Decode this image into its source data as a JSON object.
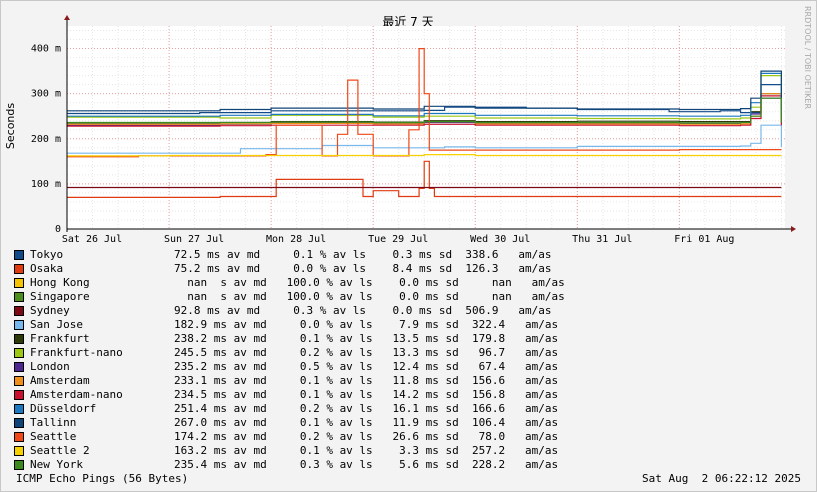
{
  "chart_data": {
    "type": "line",
    "title": "最近 7 天",
    "ylabel": "Seconds",
    "watermark": "RRDTOOL / TOBI OETIKER",
    "ylim": [
      0,
      450
    ],
    "y_ticks": [
      {
        "value": 0,
        "label": "0"
      },
      {
        "value": 100,
        "label": "100 m"
      },
      {
        "value": 200,
        "label": "200 m"
      },
      {
        "value": 300,
        "label": "300 m"
      },
      {
        "value": 400,
        "label": "400 m"
      }
    ],
    "x_range": [
      0,
      7
    ],
    "x_ticks": [
      {
        "value": 0,
        "label": "Sat 26 Jul"
      },
      {
        "value": 1,
        "label": "Sun 27 Jul"
      },
      {
        "value": 2,
        "label": "Mon 28 Jul"
      },
      {
        "value": 3,
        "label": "Tue 29 Jul"
      },
      {
        "value": 4,
        "label": "Wed 30 Jul"
      },
      {
        "value": 5,
        "label": "Thu 31 Jul"
      },
      {
        "value": 6,
        "label": "Fri 01 Aug"
      }
    ],
    "grid": true,
    "series": [
      {
        "name": "Tokyo",
        "color": "#124b8a",
        "stats": "72.5 ms av md     0.1 % av ls    0.3 ms sd  338.6   am/as",
        "x": [
          0,
          1.3,
          2.0,
          3.5,
          3.7,
          4.5,
          5.0,
          5.9,
          6.4,
          6.6,
          6.8,
          7.0
        ],
        "y": [
          256,
          258,
          262,
          263,
          270,
          268,
          265,
          260,
          262,
          258,
          320,
          255
        ]
      },
      {
        "name": "Osaka",
        "color": "#e03a10",
        "stats": "75.2 ms av md     0.0 % av ls    8.4 ms sd  126.3   am/as",
        "x": [
          0,
          0.9,
          1.5,
          1.95,
          2.05,
          2.9,
          3.0,
          3.25,
          3.45,
          3.5,
          3.55,
          3.6,
          4.2,
          5.0,
          6.0,
          6.5,
          7.0
        ],
        "y": [
          70,
          70,
          72,
          72,
          110,
          72,
          85,
          72,
          90,
          150,
          90,
          72,
          72,
          72,
          72,
          72,
          72
        ]
      },
      {
        "name": "Hong Kong",
        "color": "#f5c400",
        "stats": "  nan  s av md   100.0 % av ls    0.0 ms sd     nan   am/as",
        "x": [
          0,
          7
        ],
        "y": [
          null,
          null
        ]
      },
      {
        "name": "Singapore",
        "color": "#4b8e1e",
        "stats": "  nan  s av md   100.0 % av ls    0.0 ms sd     nan   am/as",
        "x": [
          0,
          7
        ],
        "y": [
          null,
          null
        ]
      },
      {
        "name": "Sydney",
        "color": "#7b0a14",
        "stats": "92.8 ms av md     0.3 % av ls    0.0 ms sd  506.9   am/as",
        "x": [
          0,
          7
        ],
        "y": [
          92,
          92
        ]
      },
      {
        "name": "San Jose",
        "color": "#78b8ec",
        "stats": "182.9 ms av md     0.0 % av ls    7.9 ms sd  322.4   am/as",
        "x": [
          0,
          1.0,
          1.7,
          2.5,
          3.0,
          3.7,
          4.0,
          5.0,
          6.0,
          6.6,
          6.7,
          6.8,
          7.0
        ],
        "y": [
          168,
          168,
          178,
          185,
          180,
          182,
          180,
          183,
          183,
          184,
          190,
          230,
          182
        ]
      },
      {
        "name": "Frankfurt",
        "color": "#2c3a06",
        "stats": "238.2 ms av md     0.1 % av ls   13.5 ms sd  179.8   am/as",
        "x": [
          0,
          1.5,
          2.0,
          3.0,
          3.5,
          4.0,
          5.0,
          6.0,
          6.6,
          6.7,
          6.8,
          7.0
        ],
        "y": [
          235,
          236,
          238,
          237,
          240,
          238,
          239,
          238,
          238,
          260,
          300,
          238
        ]
      },
      {
        "name": "Frankfurt-nano",
        "color": "#9cc814",
        "stats": "245.5 ms av md     0.2 % av ls   13.3 ms sd   96.7   am/as",
        "x": [
          0,
          1.5,
          2.0,
          3.0,
          3.5,
          4.0,
          5.0,
          6.0,
          6.6,
          6.7,
          6.8,
          7.0
        ],
        "y": [
          248,
          246,
          252,
          248,
          250,
          246,
          245,
          244,
          246,
          270,
          340,
          245
        ]
      },
      {
        "name": "London",
        "color": "#4e2790",
        "stats": "235.2 ms av md     0.5 % av ls   12.4 ms sd   67.4   am/as",
        "x": [
          0,
          1.5,
          2.0,
          3.0,
          3.5,
          4.0,
          5.0,
          6.0,
          6.6,
          6.7,
          6.8,
          7.0
        ],
        "y": [
          230,
          232,
          235,
          234,
          236,
          235,
          235,
          234,
          236,
          255,
          290,
          235
        ]
      },
      {
        "name": "Amsterdam",
        "color": "#f0901a",
        "stats": "233.1 ms av md     0.1 % av ls   11.8 ms sd  156.6   am/as",
        "x": [
          0,
          1.5,
          2.0,
          3.0,
          3.5,
          4.0,
          5.0,
          6.0,
          6.6,
          6.7,
          6.8,
          7.0
        ],
        "y": [
          232,
          233,
          234,
          233,
          238,
          233,
          233,
          232,
          233,
          250,
          300,
          233
        ]
      },
      {
        "name": "Amsterdam-nano",
        "color": "#c8102e",
        "stats": "234.5 ms av md     0.1 % av ls   14.2 ms sd  156.8   am/as",
        "x": [
          0,
          1.5,
          2.0,
          3.0,
          3.5,
          4.0,
          5.0,
          6.0,
          6.6,
          6.7,
          6.8,
          7.0
        ],
        "y": [
          228,
          229,
          230,
          230,
          232,
          230,
          230,
          229,
          230,
          245,
          295,
          230
        ]
      },
      {
        "name": "Düsseldorf",
        "color": "#1e78c0",
        "stats": "251.4 ms av md     0.2 % av ls   16.1 ms sd  166.6   am/as",
        "x": [
          0,
          1.5,
          2.0,
          3.0,
          3.5,
          4.0,
          5.0,
          6.0,
          6.6,
          6.7,
          6.8,
          7.0
        ],
        "y": [
          250,
          252,
          254,
          251,
          256,
          252,
          251,
          250,
          252,
          280,
          345,
          251
        ]
      },
      {
        "name": "Tallinn",
        "color": "#0f4478",
        "stats": "267.0 ms av md     0.1 % av ls   11.9 ms sd  106.4   am/as",
        "x": [
          0,
          1.5,
          2.0,
          3.0,
          3.5,
          4.0,
          5.0,
          6.0,
          6.6,
          6.7,
          6.8,
          7.0
        ],
        "y": [
          262,
          265,
          268,
          266,
          272,
          268,
          266,
          265,
          267,
          290,
          350,
          267
        ]
      },
      {
        "name": "Seattle",
        "color": "#f04818",
        "stats": "174.2 ms av md     0.2 % av ls   26.6 ms sd   78.0   am/as",
        "x": [
          0,
          0.7,
          1.5,
          1.95,
          2.05,
          2.5,
          2.65,
          2.75,
          2.85,
          3.0,
          3.35,
          3.45,
          3.5,
          3.55,
          3.65,
          4.0,
          5.0,
          6.0,
          7.0
        ],
        "y": [
          160,
          162,
          162,
          165,
          230,
          162,
          210,
          330,
          210,
          162,
          220,
          400,
          300,
          175,
          175,
          175,
          175,
          176,
          176
        ]
      },
      {
        "name": "Seattle 2",
        "color": "#f7d000",
        "stats": "163.2 ms av md     0.1 % av ls    3.3 ms sd  257.2   am/as",
        "x": [
          0,
          1.0,
          2.0,
          3.0,
          3.5,
          4.0,
          5.0,
          6.0,
          7.0
        ],
        "y": [
          162,
          163,
          163,
          163,
          165,
          163,
          163,
          163,
          163
        ]
      },
      {
        "name": "New York",
        "color": "#3a8a20",
        "stats": "235.4 ms av md     0.3 % av ls    5.6 ms sd  228.2   am/as",
        "x": [
          0,
          1.5,
          2.0,
          3.0,
          3.5,
          4.0,
          5.0,
          6.0,
          6.6,
          6.7,
          6.8,
          7.0
        ],
        "y": [
          236,
          236,
          237,
          236,
          238,
          236,
          236,
          235,
          236,
          250,
          290,
          236
        ]
      }
    ],
    "legend_placement": "bottom"
  },
  "footer": {
    "left": "ICMP Echo Pings (56 Bytes)",
    "right": "Sat Aug  2 06:22:12 2025"
  }
}
